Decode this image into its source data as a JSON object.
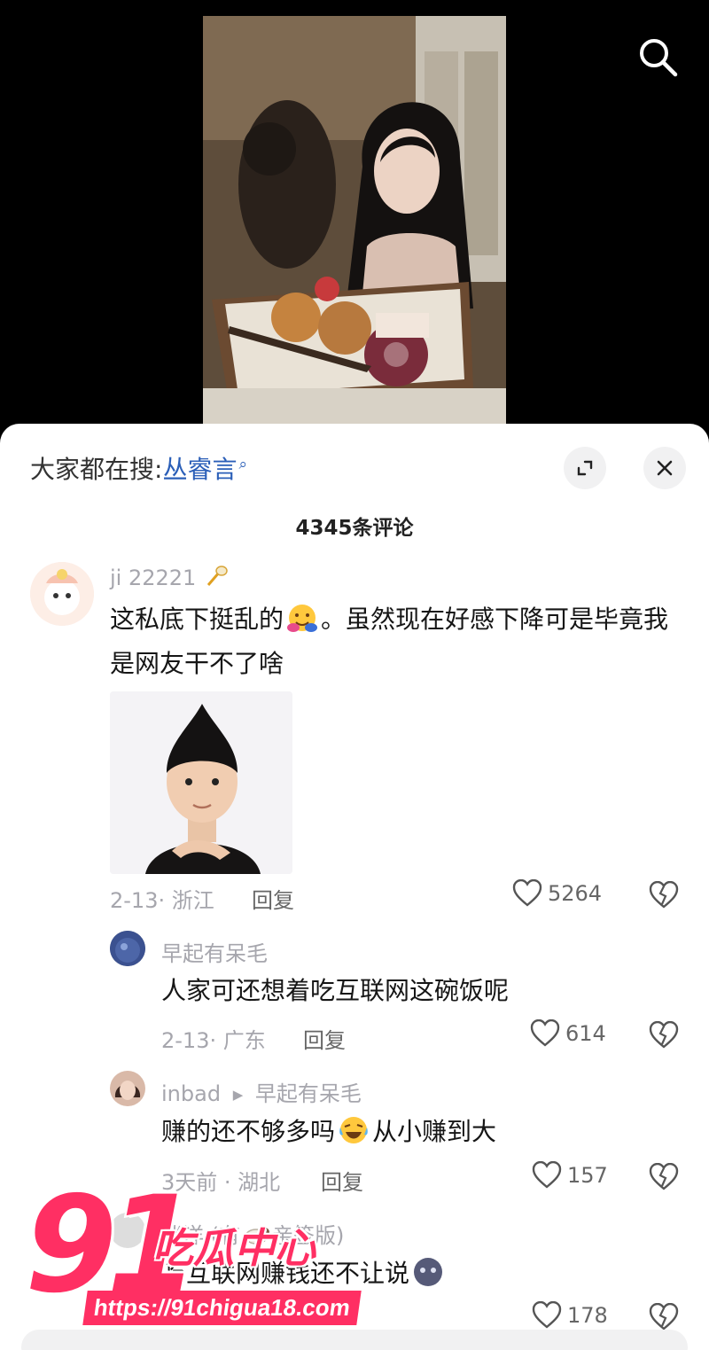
{
  "header": {
    "search_icon": "search-icon"
  },
  "video": {
    "description_icon": "video-frame"
  },
  "sheet": {
    "search_prefix": "大家都在搜:",
    "search_keyword": "丛睿言",
    "expand_icon": "expand-icon",
    "close_icon": "close-icon",
    "comment_count": "4345条评论"
  },
  "comments": [
    {
      "username": "ji 22221",
      "text_part1": "这私底下挺乱的",
      "text_part2": "。虽然现在好感下降可是毕竟我是网友干不了啥",
      "date": "2-13",
      "location": "浙江",
      "reply_label": "回复",
      "likes": "5264"
    }
  ],
  "replies": [
    {
      "username": "早起有呆毛",
      "text": "人家可还想着吃互联网这碗饭呢",
      "date": "2-13",
      "location": "广东",
      "reply_label": "回复",
      "likes": "614"
    },
    {
      "username": "inbad",
      "reply_to": "早起有呆毛",
      "text_part1": "赚的还不够多吗",
      "text_part2": "从小赚到大",
      "date": "3天前",
      "location": "湖北",
      "reply_label": "回复",
      "likes": "157"
    },
    {
      "username": "伴洋 (有",
      "username_tail": "亲签版)",
      "text": "吃互联网赚钱还不让说",
      "likes": "178"
    }
  ],
  "watermark": {
    "number": "91",
    "name": "吃瓜中心",
    "url": "https://91chigua18.com"
  },
  "colors": {
    "accent": "#2b5fb8",
    "watermark": "#ff2f63",
    "meta": "#a6a6ad"
  }
}
